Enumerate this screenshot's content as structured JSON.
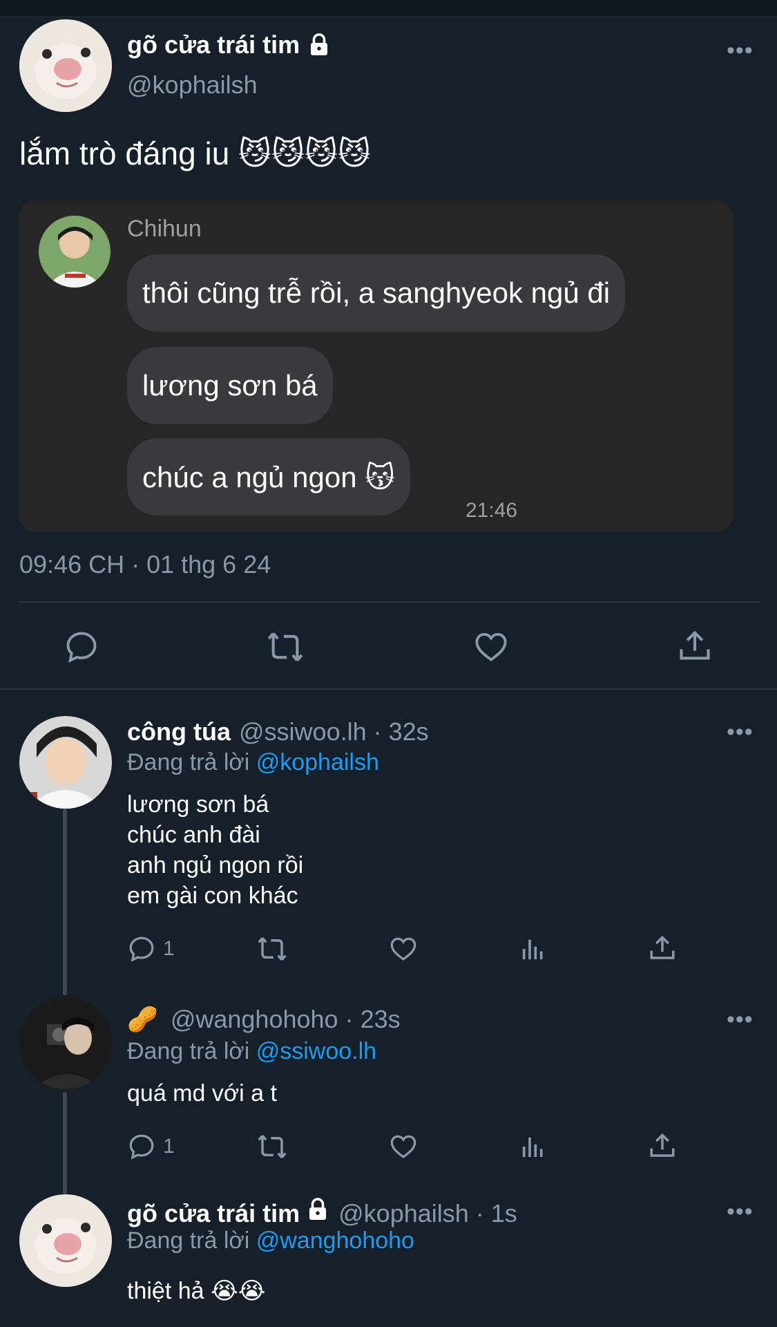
{
  "main_tweet": {
    "author_name": "gõ cửa trái tim",
    "author_handle": "@kophailsh",
    "text": "lắm trò đáng iu 😼😼😼😼",
    "embedded_chat": {
      "sender": "Chihun",
      "messages": [
        "thôi cũng trễ rồi, a sanghyeok ngủ đi",
        "lương sơn bá",
        "chúc a ngủ ngon 😽"
      ],
      "time": "21:46"
    },
    "timestamp": "09:46 CH · 01 thg 6 24",
    "actions": [
      "reply-icon",
      "retweet-icon",
      "like-icon",
      "share-icon"
    ]
  },
  "replies": [
    {
      "author_name": "công túa",
      "author_handle": "@ssiwoo.lh",
      "time": "· 32s",
      "replying_prefix": "Đang trả lời",
      "replying_to": "@kophailsh",
      "lines": [
        "lương sơn bá",
        "chúc anh đài",
        "anh ngủ ngon rồi",
        "em gài con khác"
      ],
      "reply_count": "1"
    },
    {
      "author_name": "🥜",
      "author_handle": "@wanghohoho",
      "time": "· 23s",
      "replying_prefix": "Đang trả lời",
      "replying_to": "@ssiwoo.lh",
      "lines": [
        "quá md với a t"
      ],
      "reply_count": "1"
    },
    {
      "author_name": "gõ cửa trái tim",
      "author_handle": "@kophailsh",
      "time": "· 1s",
      "replying_prefix": "Đang trả lời",
      "replying_to": "@wanghohoho",
      "lines": [
        "thiệt hả 😭😭"
      ]
    }
  ],
  "more_label": "•••",
  "colors": {
    "background": "#15202b",
    "link": "#1d9bf0",
    "muted": "#8b98a5",
    "chat_bg": "#262626",
    "bubble_bg": "#3a3a3c"
  }
}
